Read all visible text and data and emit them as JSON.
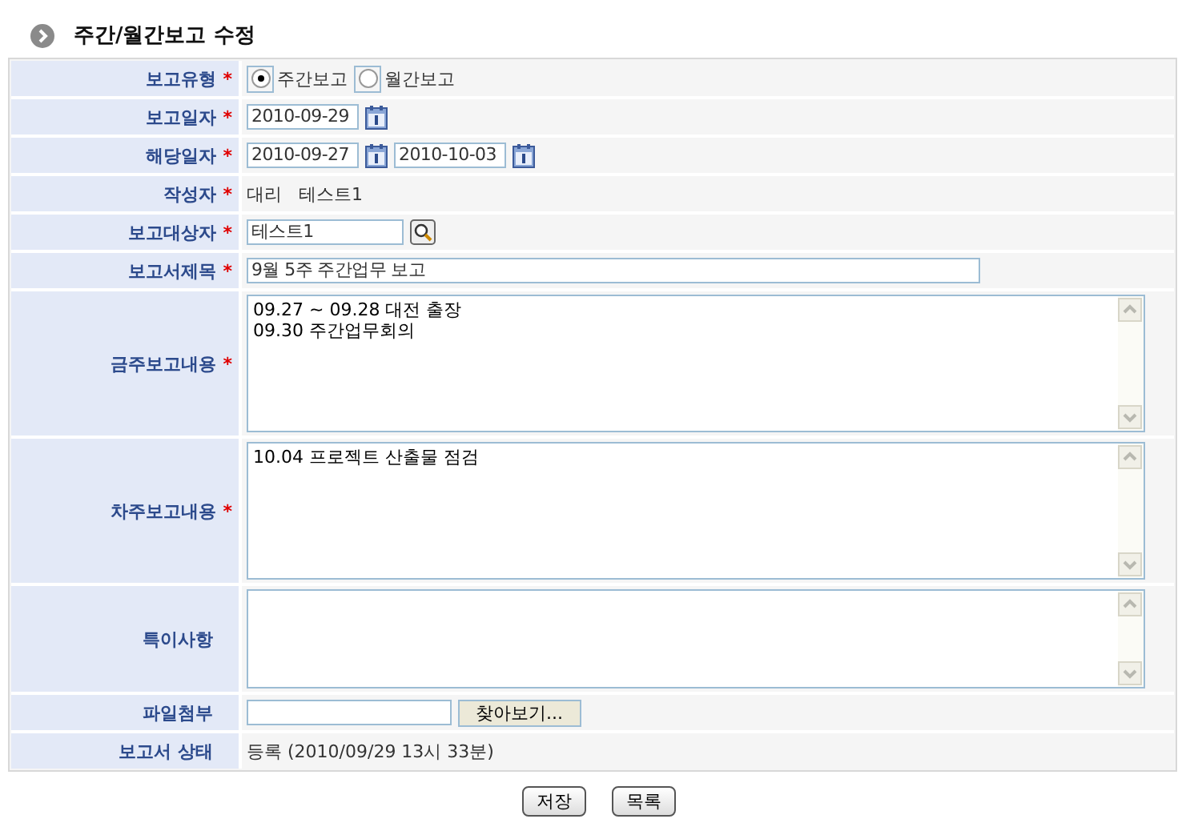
{
  "title": "주간/월간보고 수정",
  "rows": [
    {
      "kind": "radio",
      "label": "보고유형",
      "mark": "*",
      "options": [
        {
          "label": "주간보고",
          "selected": true
        },
        {
          "label": "월간보고",
          "selected": false
        }
      ]
    },
    {
      "kind": "date",
      "label": "보고일자",
      "mark": "*",
      "dates": [
        "2010-09-29"
      ]
    },
    {
      "kind": "date",
      "label": "해당일자",
      "mark": "*",
      "dates": [
        "2010-09-27",
        "2010-10-03"
      ]
    },
    {
      "kind": "text",
      "label": "작성자",
      "mark": "*",
      "parts": [
        "대리",
        "테스트1"
      ]
    },
    {
      "kind": "person",
      "label": "보고대상자",
      "mark": "*",
      "value": "테스트1"
    },
    {
      "kind": "input",
      "label": "보고서제목",
      "mark": "*",
      "value": "9월 5주 주간업무 보고"
    },
    {
      "kind": "textarea",
      "label": "금주보고내용",
      "mark": "*",
      "lines": [
        "09.27 ~ 09.28 대전 출장",
        "09.30 주간업무회의"
      ]
    },
    {
      "kind": "textarea",
      "label": "차주보고내용",
      "mark": "*",
      "lines": [
        "10.04 프로젝트 산출물 점검"
      ]
    },
    {
      "kind": "memo",
      "label": "특이사항"
    },
    {
      "kind": "file",
      "label": "파일첨부",
      "button": "찾아보기..."
    },
    {
      "kind": "text",
      "label": "보고서 상태",
      "parts": [
        "등록 (2010/09/29 13시 33분)"
      ]
    }
  ],
  "buttons": [
    "저장",
    "목록"
  ]
}
